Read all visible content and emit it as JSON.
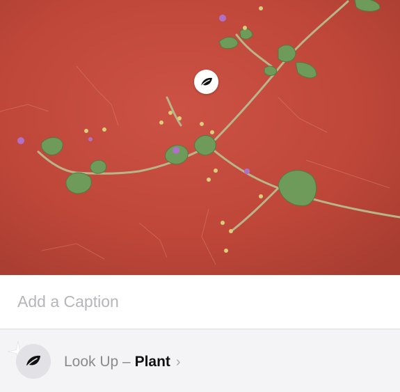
{
  "photo": {
    "badge_icon": "leaf-icon"
  },
  "caption": {
    "placeholder": "Add a Caption",
    "value": ""
  },
  "lookup": {
    "icon": "leaf-icon",
    "prefix": "Look Up – ",
    "subject": "Plant",
    "chevron": "›"
  },
  "colors": {
    "wall": "#c0483a",
    "leaf": "#6e9a5a",
    "flower": "#b070c8",
    "panel": "#f4f4f6"
  }
}
